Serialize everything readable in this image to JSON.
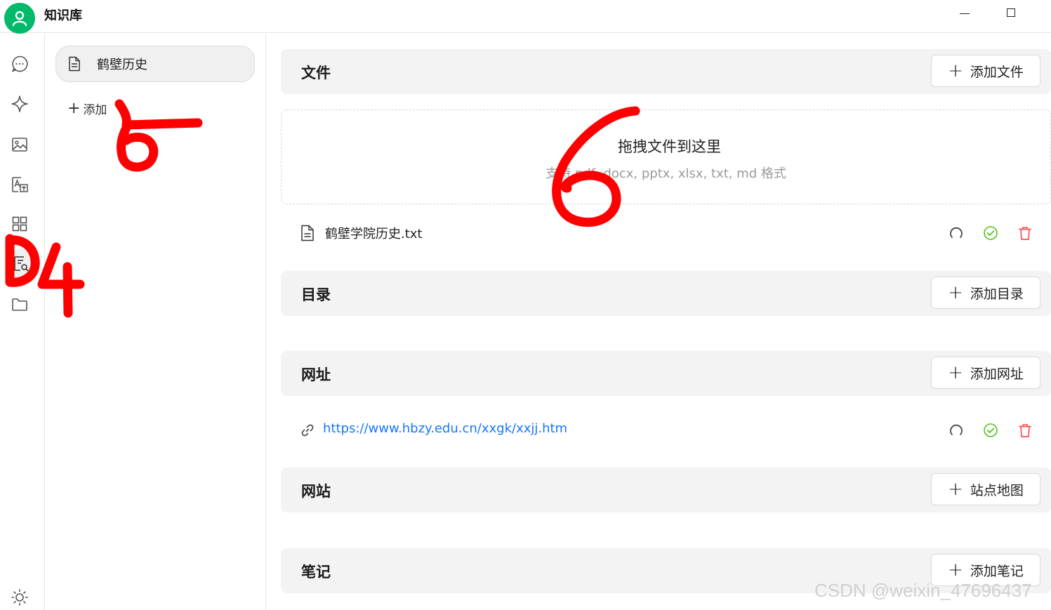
{
  "app": {
    "title": "知识库"
  },
  "rail": {
    "items": [
      {
        "icon": "chat-icon"
      },
      {
        "icon": "sparkle-icon"
      },
      {
        "icon": "image-icon"
      },
      {
        "icon": "translate-icon"
      },
      {
        "icon": "apps-grid-icon"
      },
      {
        "icon": "knowledge-search-icon",
        "active": true
      },
      {
        "icon": "folder-icon"
      }
    ],
    "bottom_icon": "theme-sun-icon"
  },
  "kb_list": {
    "items": [
      {
        "label": "鹤壁历史",
        "icon": "document-icon"
      }
    ],
    "add_label": "添加"
  },
  "sections": {
    "files": {
      "title": "文件",
      "button": "添加文件",
      "dropzone_title": "拖拽文件到这里",
      "dropzone_sub": "支持 pdf, docx, pptx, xlsx, txt, md 格式",
      "items": [
        {
          "name": "鹤壁学院历史.txt"
        }
      ]
    },
    "directory": {
      "title": "目录",
      "button": "添加目录"
    },
    "urls": {
      "title": "网址",
      "button": "添加网址",
      "items": [
        {
          "url": "https://www.hbzy.edu.cn/xxgk/xxjj.htm"
        }
      ]
    },
    "website": {
      "title": "网站",
      "button": "站点地图"
    },
    "notes": {
      "title": "笔记",
      "button": "添加笔记"
    }
  },
  "annotations": [
    "4",
    "5",
    "6"
  ],
  "watermark": "CSDN @weixin_47696437",
  "colors": {
    "brand_green": "#00b96b",
    "link_blue": "#1677ff",
    "success_green": "#52c41a",
    "danger_red": "#ff4d4f",
    "annotation_red": "#ff0000"
  }
}
